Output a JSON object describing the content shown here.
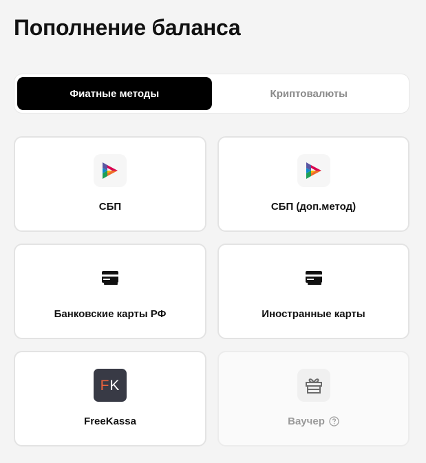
{
  "page": {
    "title": "Пополнение баланса"
  },
  "tabs": [
    {
      "label": "Фиатные методы",
      "active": true
    },
    {
      "label": "Криптовалюты",
      "active": false
    }
  ],
  "methods": [
    {
      "label": "СБП",
      "icon": "sbp-logo-icon",
      "enabled": true
    },
    {
      "label": "СБП (доп.метод)",
      "icon": "sbp-logo-icon",
      "enabled": true
    },
    {
      "label": "Банковские карты РФ",
      "icon": "bank-card-icon",
      "enabled": true
    },
    {
      "label": "Иностранные карты",
      "icon": "bank-card-icon",
      "enabled": true
    },
    {
      "label": "FreeKassa",
      "icon": "freekassa-logo-icon",
      "logo_letters": "FK",
      "enabled": true
    },
    {
      "label": "Ваучер",
      "icon": "gift-voucher-icon",
      "enabled": false,
      "help_icon": "question-circle-icon"
    }
  ],
  "colors": {
    "background": "#f4f4f4",
    "active_tab": "#000000",
    "freekassa_bg": "#383a45",
    "freekassa_accent": "#e8613c"
  }
}
